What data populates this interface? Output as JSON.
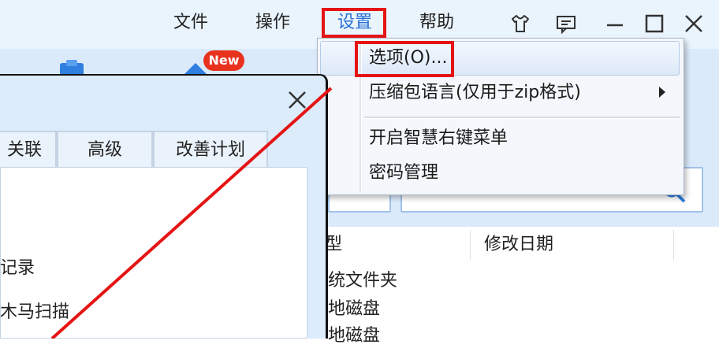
{
  "menubar": {
    "items": [
      {
        "label": "文件"
      },
      {
        "label": "操作"
      },
      {
        "label": "设置"
      },
      {
        "label": "帮助"
      }
    ]
  },
  "window_controls": {
    "icons": [
      "skin-icon",
      "message-icon",
      "minimize-icon",
      "maximize-icon",
      "close-icon"
    ]
  },
  "toolbar": {
    "new_badge": "New"
  },
  "dropdown": {
    "items": [
      {
        "label": "选项(O)..."
      },
      {
        "label": "压缩包语言(仅用于zip格式)"
      },
      {
        "label": "开启智慧右键菜单"
      },
      {
        "label": "密码管理"
      }
    ]
  },
  "file_list": {
    "columns": [
      {
        "label": "型"
      },
      {
        "label": "修改日期"
      }
    ],
    "rows": [
      {
        "label": "统文件夹"
      },
      {
        "label": "地磁盘"
      },
      {
        "label": "地磁盘"
      }
    ]
  },
  "dialog": {
    "tabs": [
      {
        "label": "关联"
      },
      {
        "label": "高级"
      },
      {
        "label": "改善计划"
      }
    ],
    "lines": [
      {
        "label": "记录"
      },
      {
        "label": "木马扫描"
      }
    ]
  },
  "colors": {
    "highlight_red": "#e51414",
    "accent_blue": "#2a6fd6",
    "badge_red": "#e8321e"
  }
}
